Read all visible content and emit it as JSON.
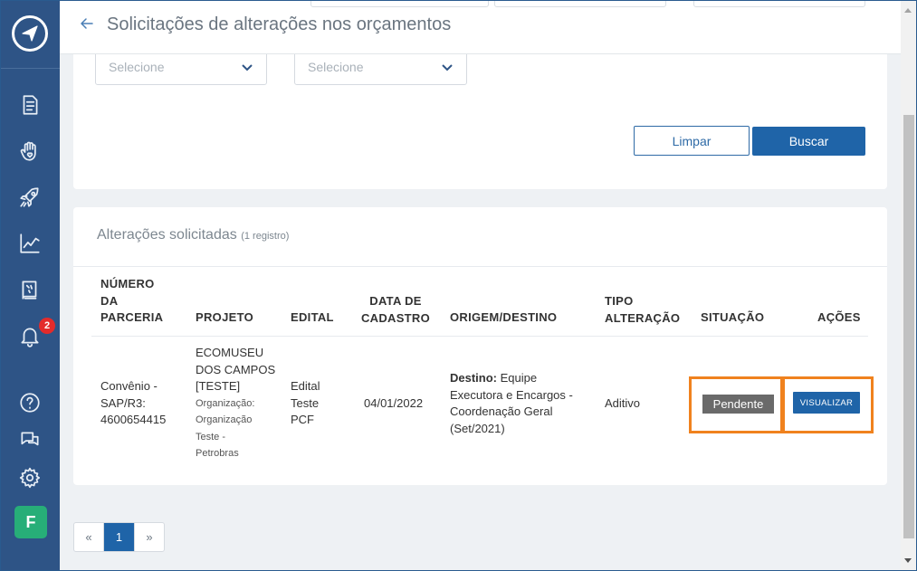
{
  "header": {
    "title": "Solicitações de alterações nos orçamentos"
  },
  "filters": {
    "select1_placeholder": "Selecione",
    "select2_placeholder": "Selecione",
    "clear_label": "Limpar",
    "search_label": "Buscar"
  },
  "results": {
    "title": "Alterações solicitadas",
    "count": "(1 registro)",
    "columns": {
      "numero": [
        "NÚMERO",
        "DA",
        "PARCERIA"
      ],
      "projeto": "PROJETO",
      "edital": "EDITAL",
      "data": [
        "DATA DE",
        "CADASTRO"
      ],
      "origem": "ORIGEM/DESTINO",
      "tipo": [
        "TIPO",
        "ALTERAÇÃO"
      ],
      "situacao": "SITUAÇÃO",
      "acoes": "AÇÕES"
    },
    "rows": [
      {
        "numero": [
          "Convênio -",
          "SAP/R3:",
          "4600654415"
        ],
        "projeto": [
          "ECOMUSEU",
          "DOS CAMPOS",
          "[TESTE]"
        ],
        "org": [
          "Organização:",
          "Organização",
          "Teste -",
          "Petrobras"
        ],
        "edital": [
          "Edital",
          "Teste",
          "PCF"
        ],
        "data": "04/01/2022",
        "origem_label": "Destino:",
        "origem": [
          " Equipe",
          "Executora e Encargos -",
          "Coordenação Geral",
          "(Set/2021)"
        ],
        "tipo": "Aditivo",
        "situacao": "Pendente",
        "acao": "VISUALIZAR"
      }
    ]
  },
  "pagination": {
    "prev": "«",
    "current": "1",
    "next": "»"
  },
  "sidebar": {
    "notification_count": "2",
    "avatar_letter": "F"
  },
  "colors": {
    "sidebar": "#2e5486",
    "primary": "#1f64a8",
    "status": "#6a6a6a",
    "highlight": "#f0821e",
    "badge": "#e32b2b",
    "avatar": "#27ae78"
  }
}
